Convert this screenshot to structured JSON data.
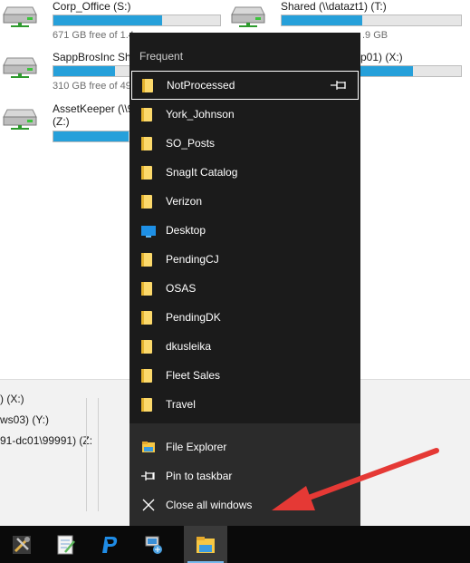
{
  "explorer": {
    "drives": [
      {
        "name": "Corp_Office (S:)",
        "free": "671 GB free of 1.4",
        "fill": 0.65
      },
      {
        "name": "Shared (\\\\datazt1) (T:)",
        "free": ".9 GB",
        "fill": 0.45
      },
      {
        "name": "SappBrosInc Sha",
        "free": "310 GB free of 49",
        "fill": 0.37
      },
      {
        "name": "p01) (X:)",
        "free": "",
        "fill": 0.73
      },
      {
        "name": "AssetKeeper (\\\\9",
        "name2": "(Z:)",
        "free": "",
        "fill": 0.45
      }
    ],
    "lower_lines": [
      ") (X:)",
      "ws03) (Y:)",
      "91-dc01\\99991) (Z:"
    ]
  },
  "jumplist": {
    "heading": "Frequent",
    "items": [
      {
        "label": "NotProcessed",
        "icon": "folder-icon"
      },
      {
        "label": "York_Johnson",
        "icon": "folder-icon"
      },
      {
        "label": "SO_Posts",
        "icon": "folder-icon"
      },
      {
        "label": "SnagIt Catalog",
        "icon": "folder-icon"
      },
      {
        "label": "Verizon",
        "icon": "folder-icon"
      },
      {
        "label": "Desktop",
        "icon": "desktop-icon"
      },
      {
        "label": "PendingCJ",
        "icon": "folder-icon"
      },
      {
        "label": "OSAS",
        "icon": "folder-icon"
      },
      {
        "label": "PendingDK",
        "icon": "folder-icon"
      },
      {
        "label": "dkusleika",
        "icon": "folder-icon"
      },
      {
        "label": "Fleet Sales",
        "icon": "folder-icon"
      },
      {
        "label": "Travel",
        "icon": "folder-icon"
      }
    ],
    "tasks": [
      {
        "label": "File Explorer",
        "icon": "file-explorer-icon"
      },
      {
        "label": "Pin to taskbar",
        "icon": "pin-icon"
      },
      {
        "label": "Close all windows",
        "icon": "close-icon"
      }
    ]
  },
  "taskbar": {
    "apps": [
      "tools-icon",
      "notepad-icon",
      "paypal-icon",
      "network-icon",
      "file-explorer-icon"
    ]
  },
  "colors": {
    "accent": "#26a0da",
    "jumplist_bg": "#1b1b1b",
    "tasks_bg": "#2b2b2b",
    "arrow": "#e53935"
  }
}
